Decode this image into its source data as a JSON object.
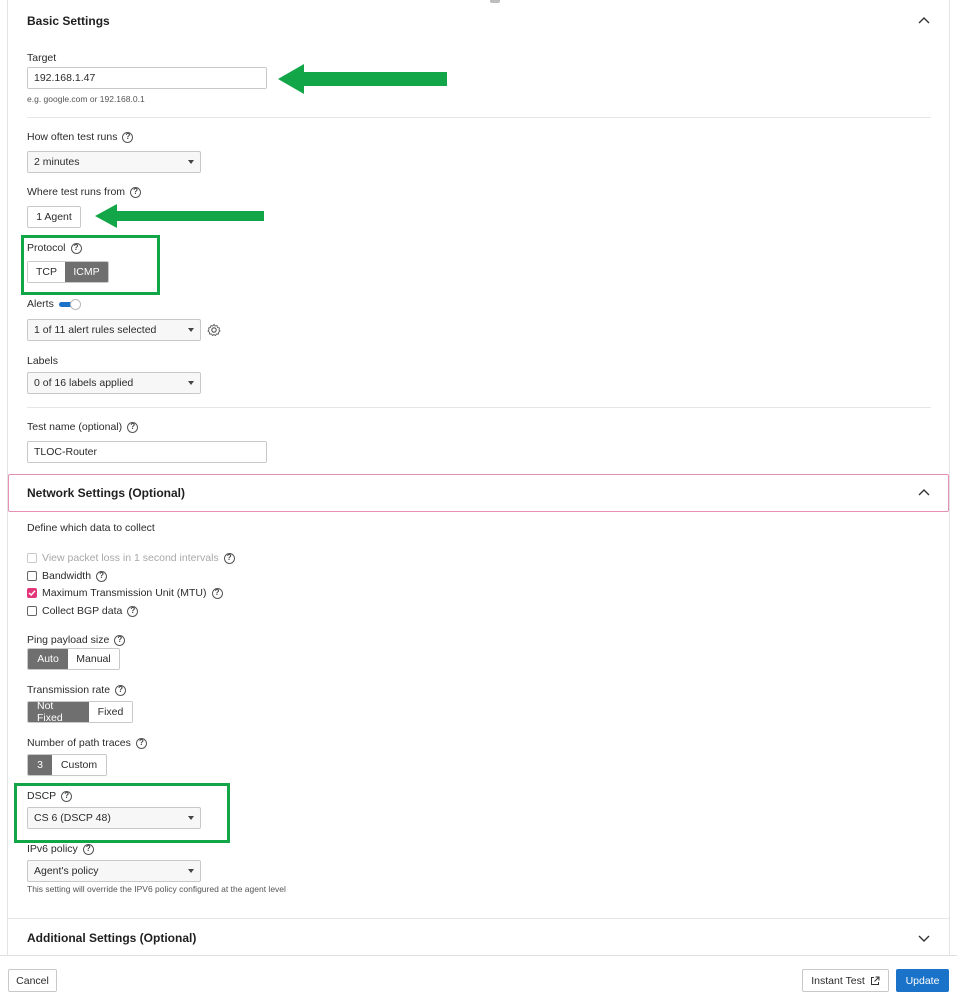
{
  "colors": {
    "accent": "#1a73c8",
    "highlight": "#13a648",
    "checkbox": "#e2357a",
    "segment_active": "#6f6f6f"
  },
  "basic": {
    "title": "Basic Settings",
    "target": {
      "label": "Target",
      "value": "192.168.1.47",
      "hint": "e.g. google.com or 192.168.0.1"
    },
    "frequency": {
      "label": "How often test runs",
      "value": "2 minutes"
    },
    "where": {
      "label": "Where test runs from",
      "button": "1 Agent"
    },
    "protocol": {
      "label": "Protocol",
      "options": [
        "TCP",
        "ICMP"
      ],
      "selected": "ICMP"
    },
    "alerts": {
      "label": "Alerts",
      "enabled": true,
      "value": "1 of 11 alert rules selected"
    },
    "labels": {
      "label": "Labels",
      "value": "0 of 16 labels applied"
    },
    "test_name": {
      "label": "Test name (optional)",
      "value": "TLOC-Router"
    }
  },
  "network": {
    "title": "Network Settings (Optional)",
    "define_label": "Define which data to collect",
    "checks": [
      {
        "label": "View packet loss in 1 second intervals",
        "checked": false,
        "disabled": true
      },
      {
        "label": "Bandwidth",
        "checked": false,
        "disabled": false
      },
      {
        "label": "Maximum Transmission Unit (MTU)",
        "checked": true,
        "disabled": false
      },
      {
        "label": "Collect BGP data",
        "checked": false,
        "disabled": false
      }
    ],
    "ping_payload": {
      "label": "Ping payload size",
      "options": [
        "Auto",
        "Manual"
      ],
      "selected": "Auto"
    },
    "transmission": {
      "label": "Transmission rate",
      "options": [
        "Not Fixed",
        "Fixed"
      ],
      "selected": "Not Fixed"
    },
    "path_traces": {
      "label": "Number of path traces",
      "options": [
        "3",
        "Custom"
      ],
      "selected": "3"
    },
    "dscp": {
      "label": "DSCP",
      "value": "CS 6 (DSCP 48)"
    },
    "ipv6": {
      "label": "IPv6 policy",
      "value": "Agent's policy",
      "hint": "This setting will override the IPV6 policy configured at the agent level"
    }
  },
  "additional": {
    "title": "Additional Settings (Optional)"
  },
  "footer": {
    "cancel": "Cancel",
    "instant": "Instant Test",
    "update": "Update"
  },
  "icons": {
    "collapse": "chevron-up-icon",
    "expand": "chevron-down-icon",
    "help": "question-circle-icon",
    "settings": "gear-icon",
    "external": "external-link-icon"
  }
}
